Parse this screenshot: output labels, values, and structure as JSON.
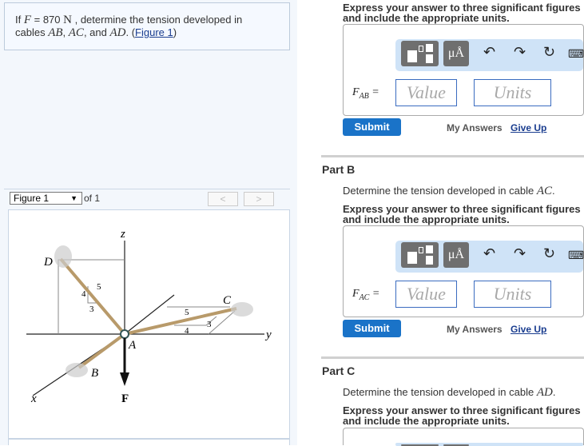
{
  "problem": {
    "prefix": "If ",
    "var_F": "F",
    "eq": " = 870 ",
    "unit": "N",
    "mid": " , determine the tension developed in",
    "line2a": "cables ",
    "AB": "AB",
    "comma1": ", ",
    "AC": "AC",
    "and": ", and ",
    "AD": "AD",
    "dot": ". (",
    "figure_link": "Figure 1",
    "close": ")"
  },
  "figure_bar": {
    "select_value": "Figure 1",
    "of": "of 1",
    "prev": "<",
    "next": ">"
  },
  "figure": {
    "labels": {
      "z": "z",
      "y": "y",
      "x": "x",
      "D": "D",
      "C": "C",
      "B": "B",
      "A": "A",
      "F": "F",
      "n5a": "5",
      "n4a": "4",
      "n3a": "3",
      "n5b": "5",
      "n4b": "4",
      "n3b": "3"
    },
    "cable_color": "#b89a6a"
  },
  "parts": [
    {
      "title": "",
      "question_prefix": "",
      "question_var": "",
      "express": "Express your answer to three significant figures and include the appropriate units.",
      "label_main": "F",
      "label_sub": "AB",
      "value_placeholder": "Value",
      "units_placeholder": "Units",
      "submit": "Submit",
      "my_answers": "My Answers",
      "give_up": "Give Up"
    },
    {
      "title": "Part B",
      "question_prefix": "Determine the tension developed in cable ",
      "question_var": "AC",
      "express": "Express your answer to three significant figures and include the appropriate units.",
      "label_main": "F",
      "label_sub": "AC",
      "value_placeholder": "Value",
      "units_placeholder": "Units",
      "submit": "Submit",
      "my_answers": "My Answers",
      "give_up": "Give Up"
    },
    {
      "title": "Part C",
      "question_prefix": "Determine the tension developed in cable ",
      "question_var": "AD",
      "express": "Express your answer to three significant figures and include the appropriate units."
    }
  ],
  "toolbar": {
    "units_btn": "μÅ",
    "icons": [
      "templates-icon",
      "units-icon",
      "undo-icon",
      "redo-icon",
      "reset-icon",
      "keyboard-icon"
    ]
  },
  "colors": {
    "accent": "#1a73c8",
    "toolbar_bg": "#cfe3f7",
    "input_border": "#3b6cc0"
  }
}
